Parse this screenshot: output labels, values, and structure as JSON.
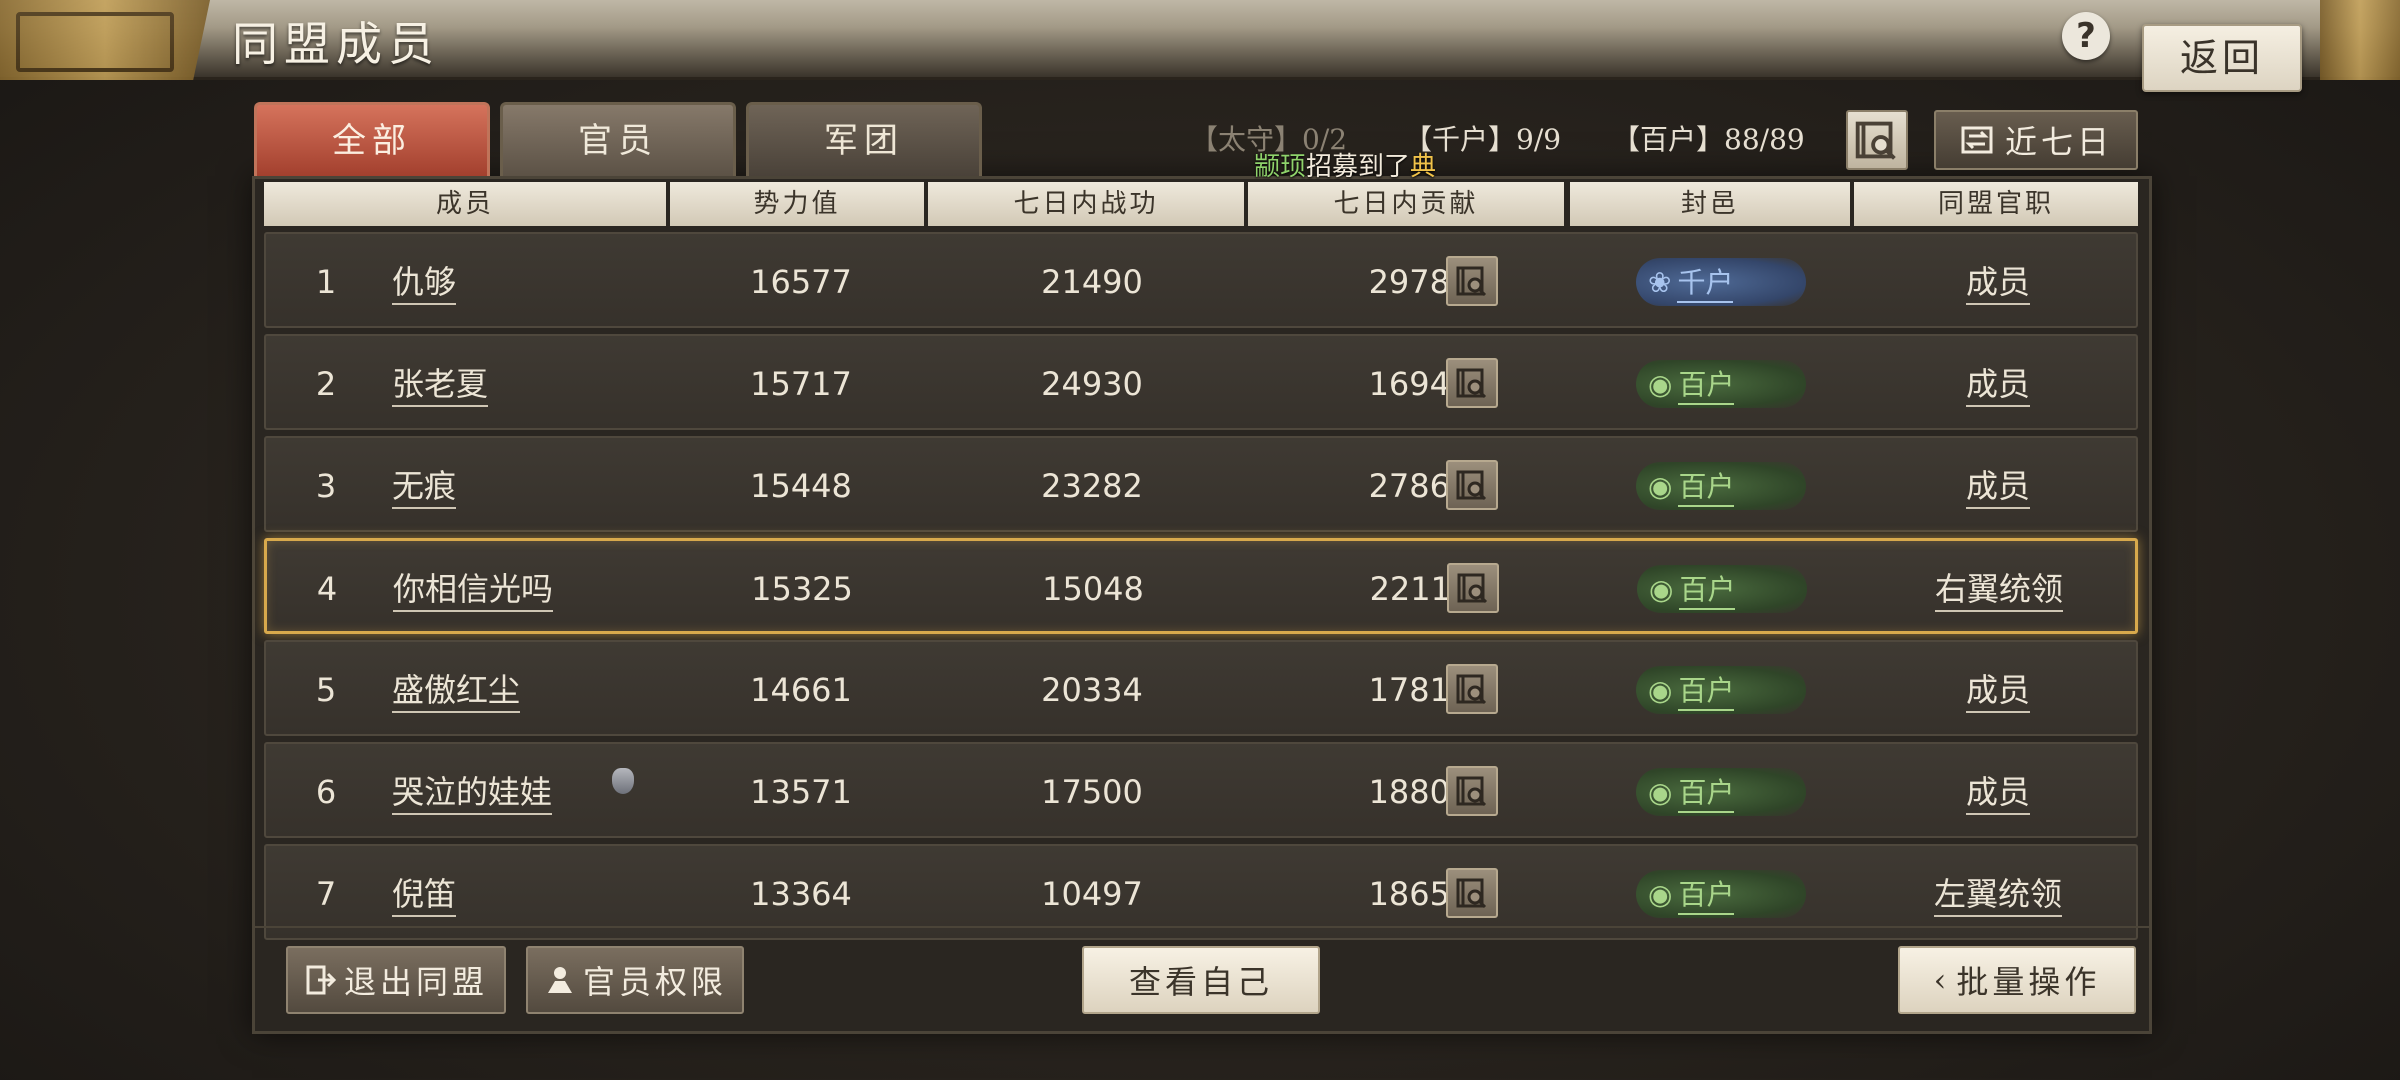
{
  "header": {
    "title": "同盟成员",
    "help_label": "?",
    "back_label": "返回"
  },
  "tabs": [
    {
      "label": "全部",
      "active": true
    },
    {
      "label": "官员",
      "active": false
    },
    {
      "label": "军团",
      "active": false
    }
  ],
  "stats": {
    "taishou": "【太守】0/2",
    "qianhu": "【千户】9/9",
    "baihu": "【百户】88/89"
  },
  "broadcast": {
    "player": "颛顼",
    "text": "招募到了",
    "item": "典"
  },
  "filter": {
    "week_label": "近七日"
  },
  "columns": [
    "成员",
    "势力值",
    "七日内战功",
    "七日内贡献",
    "封邑",
    "同盟官职"
  ],
  "rows": [
    {
      "rank": "1",
      "name": "仇够",
      "power": "16577",
      "merit": "21490",
      "contribution": "2978",
      "fief": "千户",
      "fief_color": "#a8c4ee",
      "office": "成员"
    },
    {
      "rank": "2",
      "name": "张老夏",
      "power": "15717",
      "merit": "24930",
      "contribution": "1694",
      "fief": "百户",
      "fief_color": "#a9d68a",
      "office": "成员"
    },
    {
      "rank": "3",
      "name": "无痕",
      "power": "15448",
      "merit": "23282",
      "contribution": "2786",
      "fief": "百户",
      "fief_color": "#a9d68a",
      "office": "成员"
    },
    {
      "rank": "4",
      "name": "你相信光吗",
      "power": "15325",
      "merit": "15048",
      "contribution": "2211",
      "fief": "百户",
      "fief_color": "#a9d68a",
      "office": "右翼统领"
    },
    {
      "rank": "5",
      "name": "盛傲红尘",
      "power": "14661",
      "merit": "20334",
      "contribution": "1781",
      "fief": "百户",
      "fief_color": "#a9d68a",
      "office": "成员"
    },
    {
      "rank": "6",
      "name": "哭泣的娃娃",
      "power": "13571",
      "merit": "17500",
      "contribution": "1880",
      "fief": "百户",
      "fief_color": "#a9d68a",
      "office": "成员"
    },
    {
      "rank": "7",
      "name": "倪笛",
      "power": "13364",
      "merit": "10497",
      "contribution": "1865",
      "fief": "百户",
      "fief_color": "#a9d68a",
      "office": "左翼统领"
    }
  ],
  "footer": {
    "leave_label": "退出同盟",
    "permissions_label": "官员权限",
    "view_self_label": "查看自己",
    "batch_label": "批量操作"
  },
  "colors": {
    "highlight": "#d8a94c",
    "active_tab": "#c0583f"
  }
}
